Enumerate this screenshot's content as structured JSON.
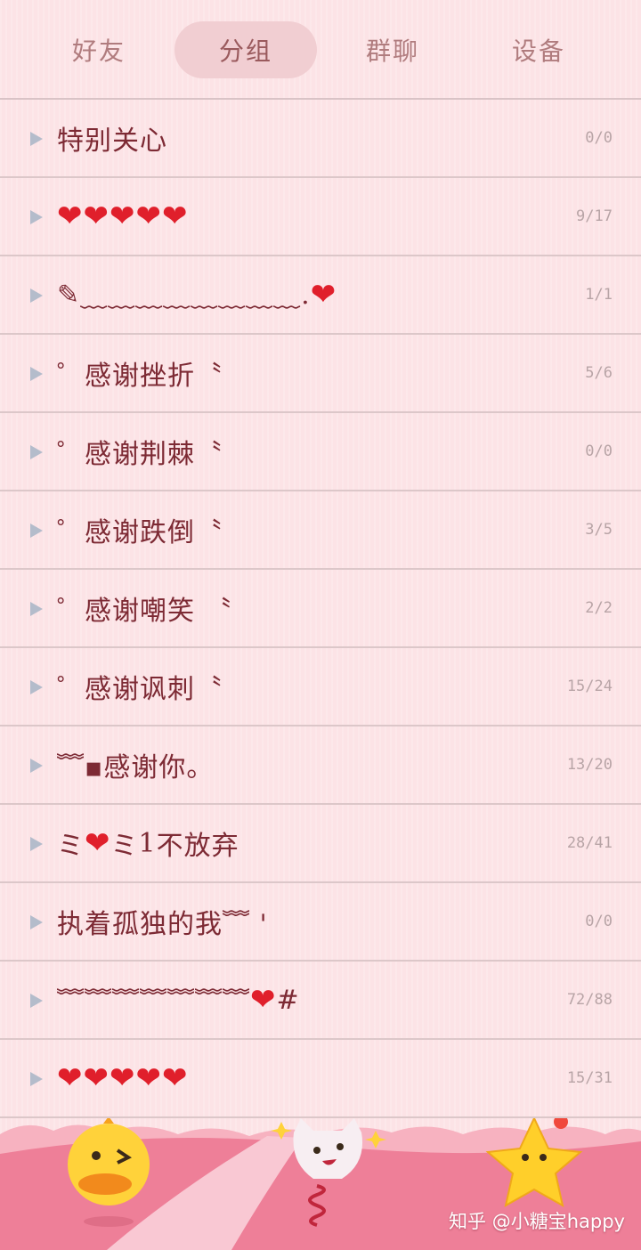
{
  "tabs": [
    {
      "label": "好友",
      "active": false
    },
    {
      "label": "分组",
      "active": true
    },
    {
      "label": "群聊",
      "active": false
    },
    {
      "label": "设备",
      "active": false
    }
  ],
  "groups": [
    {
      "name": "特别关心",
      "count": "0/0"
    },
    {
      "name": "❤ ❤ ❤ ❤ ❤",
      "count": "9/17"
    },
    {
      "name": "✎﹏﹏﹏﹏﹏﹏﹏﹏.❤",
      "count": "1/1"
    },
    {
      "name": "゜感谢挫折〝",
      "count": "5/6"
    },
    {
      "name": "゜感谢荆棘〝",
      "count": "0/0"
    },
    {
      "name": "゜感谢跌倒〝",
      "count": "3/5"
    },
    {
      "name": "゜感谢嘲笑 〝",
      "count": "2/2"
    },
    {
      "name": "゜感谢讽刺〝",
      "count": "15/24"
    },
    {
      "name": "﹌▪感谢你。",
      "count": "13/20"
    },
    {
      "name": "ミ❤ミ1 不放弃",
      "count": "28/41"
    },
    {
      "name": "执着孤独的我﹌ ' ",
      "count": "0/0"
    },
    {
      "name": "﹌﹌﹌﹌﹌﹌﹌ ❤ #",
      "count": "72/88"
    },
    {
      "name": "❤ ❤ ❤ ❤ ❤",
      "count": "15/31"
    }
  ],
  "watermark": "知乎 @小糖宝happy",
  "colors": {
    "background": "#fce3e6",
    "tab_active": "#f1ced2",
    "group_text": "#7d2a34",
    "heart": "#e01f2b"
  }
}
